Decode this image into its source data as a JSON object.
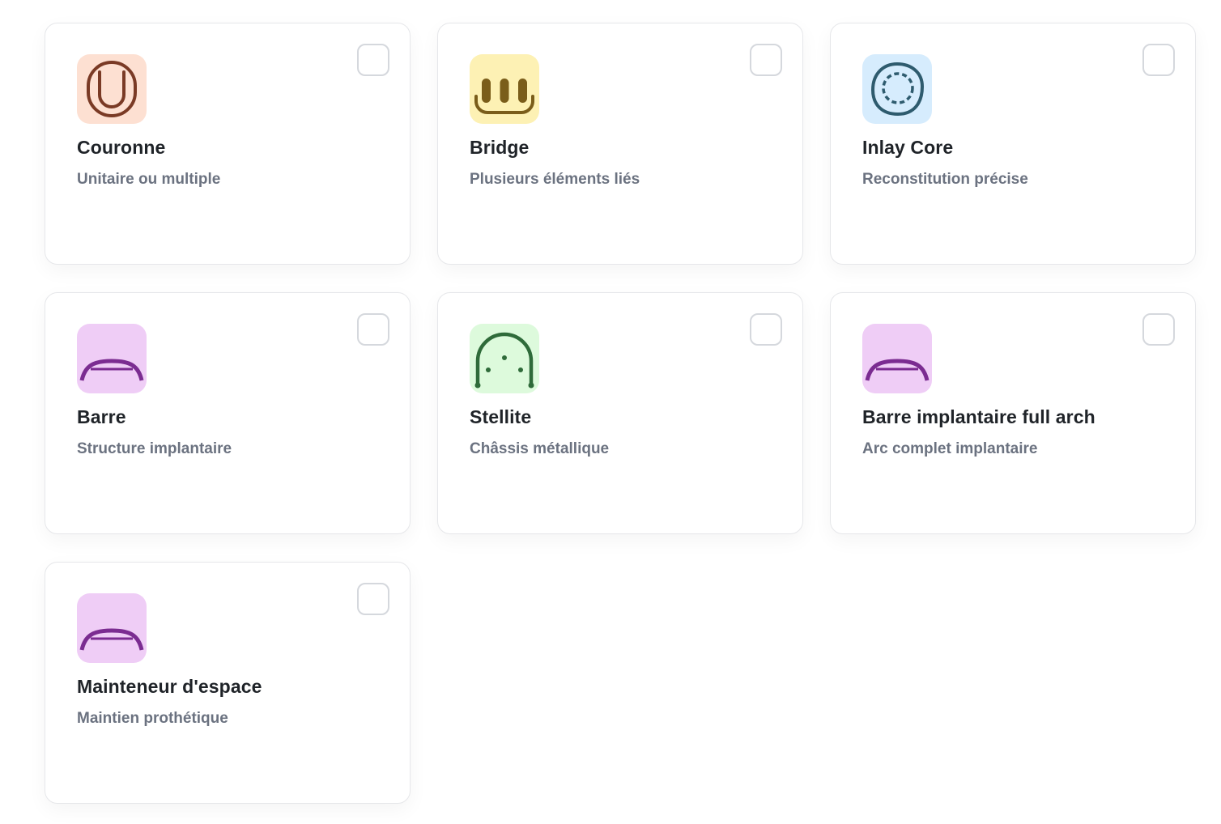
{
  "cards": [
    {
      "title": "Couronne",
      "subtitle": "Unitaire ou multiple",
      "icon": "crown-icon",
      "tile_color": "#fde0d2",
      "icon_color": "#7a3a25",
      "checked": false
    },
    {
      "title": "Bridge",
      "subtitle": "Plusieurs éléments liés",
      "icon": "bridge-icon",
      "tile_color": "#fdf1b4",
      "icon_color": "#7a5d1a",
      "checked": false
    },
    {
      "title": "Inlay Core",
      "subtitle": "Reconstitution précise",
      "icon": "inlay-core-icon",
      "tile_color": "#d6ecfd",
      "icon_color": "#2e5b6e",
      "checked": false
    },
    {
      "title": "Barre",
      "subtitle": "Structure implantaire",
      "icon": "bar-icon",
      "tile_color": "#efcdf6",
      "icon_color": "#7b2c91",
      "checked": false
    },
    {
      "title": "Stellite",
      "subtitle": "Châssis métallique",
      "icon": "stellite-icon",
      "tile_color": "#ddfadc",
      "icon_color": "#2f6b3a",
      "checked": false
    },
    {
      "title": "Barre implantaire full arch",
      "subtitle": "Arc complet implantaire",
      "icon": "full-arch-bar-icon",
      "tile_color": "#efcdf6",
      "icon_color": "#7b2c91",
      "checked": false
    },
    {
      "title": "Mainteneur d'espace",
      "subtitle": "Maintien prothétique",
      "icon": "space-maintainer-icon",
      "tile_color": "#efcdf6",
      "icon_color": "#7b2c91",
      "checked": false
    }
  ]
}
